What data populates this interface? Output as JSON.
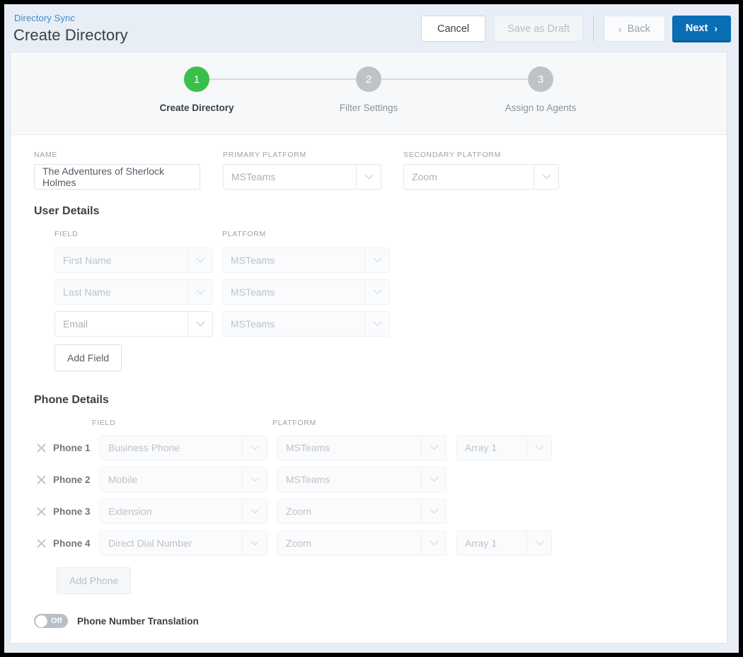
{
  "header": {
    "breadcrumb": "Directory Sync",
    "title": "Create Directory",
    "buttons": {
      "cancel": "Cancel",
      "save_draft": "Save as Draft",
      "back": "Back",
      "next": "Next"
    },
    "icons": {
      "back_chevron": "‹",
      "next_chevron": "›"
    }
  },
  "stepper": {
    "steps": [
      {
        "number": "1",
        "label": "Create Directory",
        "state": "active"
      },
      {
        "number": "2",
        "label": "Filter Settings",
        "state": "inactive"
      },
      {
        "number": "3",
        "label": "Assign to Agents",
        "state": "inactive"
      }
    ]
  },
  "top_form": {
    "name": {
      "label": "NAME",
      "value": "The Adventures of Sherlock Holmes"
    },
    "primary_platform": {
      "label": "PRIMARY PLATFORM",
      "value": "MSTeams"
    },
    "secondary_platform": {
      "label": "SECONDARY PLATFORM",
      "value": "Zoom"
    }
  },
  "user_details": {
    "title": "User Details",
    "columns": {
      "field": "FIELD",
      "platform": "PLATFORM"
    },
    "rows": [
      {
        "field": "First Name",
        "platform": "MSTeams",
        "field_state": "disabled",
        "platform_state": "disabled"
      },
      {
        "field": "Last Name",
        "platform": "MSTeams",
        "field_state": "disabled",
        "platform_state": "disabled"
      },
      {
        "field": "Email",
        "platform": "MSTeams",
        "field_state": "enabled",
        "platform_state": "disabled"
      }
    ],
    "add_button": "Add Field"
  },
  "phone_details": {
    "title": "Phone Details",
    "columns": {
      "field": "FIELD",
      "platform": "PLATFORM"
    },
    "rows": [
      {
        "name": "Phone 1",
        "field": "Business Phone",
        "platform": "MSTeams",
        "array": "Array 1"
      },
      {
        "name": "Phone 2",
        "field": "Mobile",
        "platform": "MSTeams",
        "array": null
      },
      {
        "name": "Phone 3",
        "field": "Extension",
        "platform": "Zoom",
        "array": null
      },
      {
        "name": "Phone 4",
        "field": "Direct Dial Number",
        "platform": "Zoom",
        "array": "Array 1"
      }
    ],
    "add_button": "Add Phone",
    "remove_icon": "close-icon"
  },
  "translation_toggle": {
    "state": "Off",
    "label": "Phone Number Translation"
  },
  "colors": {
    "accent_blue": "#0a6eb4",
    "link_blue": "#3c8dc5",
    "active_green": "#39c04b",
    "inactive_gray": "#bdc3c7",
    "page_background": "#e8eef6",
    "card_background": "#ffffff",
    "stepper_background": "#f7f8fa"
  }
}
